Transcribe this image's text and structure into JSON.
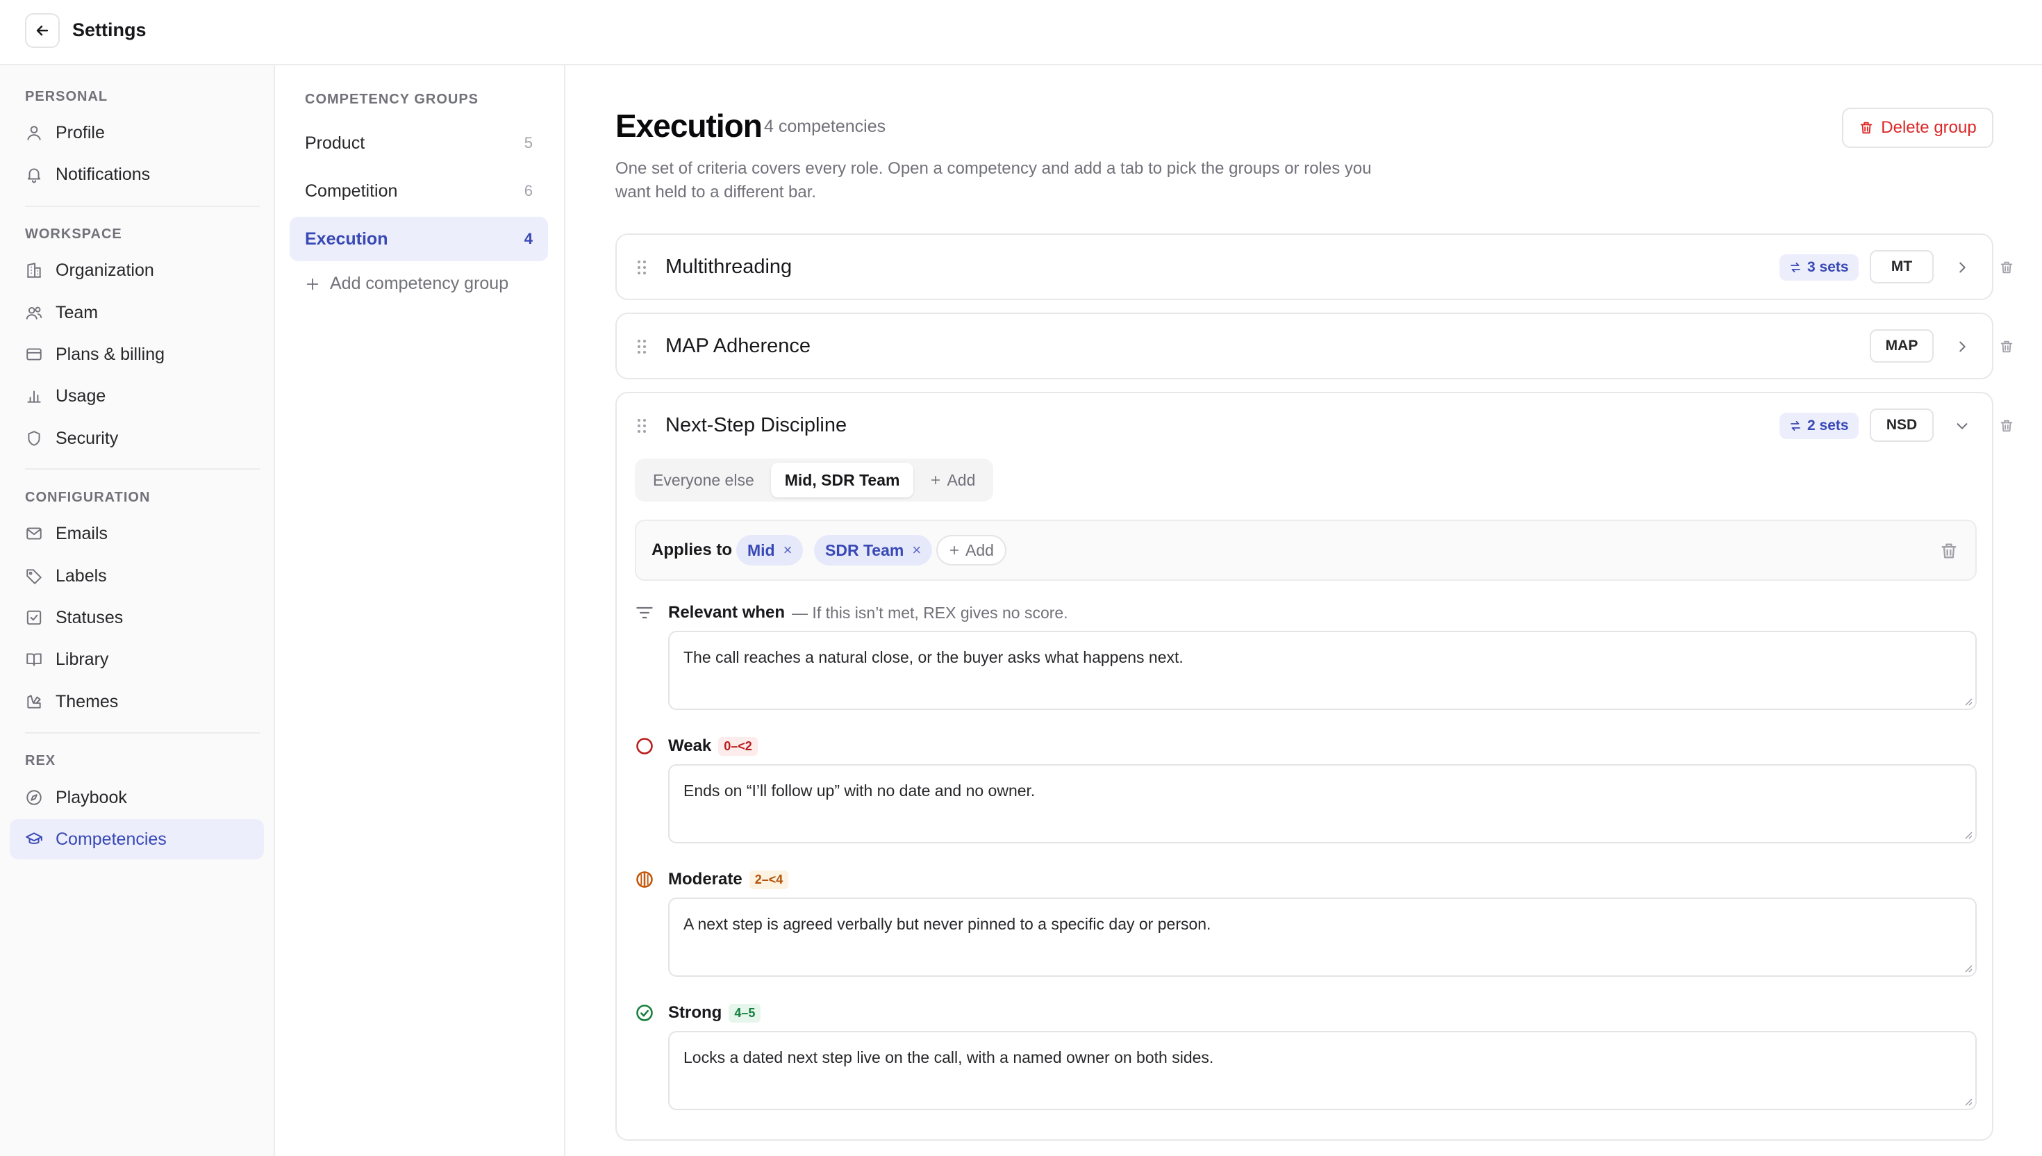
{
  "topbar": {
    "title": "Settings"
  },
  "sidebar": {
    "sections": [
      {
        "label": "PERSONAL",
        "items": [
          {
            "label": "Profile",
            "icon": "user-icon"
          },
          {
            "label": "Notifications",
            "icon": "bell-icon"
          }
        ]
      },
      {
        "label": "WORKSPACE",
        "items": [
          {
            "label": "Organization",
            "icon": "building-icon"
          },
          {
            "label": "Team",
            "icon": "users-icon"
          },
          {
            "label": "Plans & billing",
            "icon": "credit-card-icon"
          },
          {
            "label": "Usage",
            "icon": "bar-chart-icon"
          },
          {
            "label": "Security",
            "icon": "shield-icon"
          }
        ]
      },
      {
        "label": "CONFIGURATION",
        "items": [
          {
            "label": "Emails",
            "icon": "mail-icon"
          },
          {
            "label": "Labels",
            "icon": "tag-icon"
          },
          {
            "label": "Statuses",
            "icon": "check-square-icon"
          },
          {
            "label": "Library",
            "icon": "book-icon"
          },
          {
            "label": "Themes",
            "icon": "palette-icon"
          }
        ]
      },
      {
        "label": "REX",
        "items": [
          {
            "label": "Playbook",
            "icon": "compass-icon"
          },
          {
            "label": "Competencies",
            "icon": "graduation-cap-icon",
            "active": true
          }
        ]
      }
    ]
  },
  "groups": {
    "label": "COMPETENCY GROUPS",
    "items": [
      {
        "label": "Product",
        "count": "5"
      },
      {
        "label": "Competition",
        "count": "6"
      },
      {
        "label": "Execution",
        "count": "4",
        "active": true
      }
    ],
    "add_label": "Add competency group"
  },
  "main": {
    "title": "Execution",
    "subtitle": "4 competencies",
    "description": "One set of criteria covers every role. Open a competency and add a tab to pick the groups or roles you want held to a different bar.",
    "delete_label": "Delete group",
    "competencies": [
      {
        "name": "Multithreading",
        "sets": "3 sets",
        "code": "MT"
      },
      {
        "name": "MAP Adherence",
        "code": "MAP"
      },
      {
        "name": "Next-Step Discipline",
        "sets": "2 sets",
        "code": "NSD",
        "tabs": [
          "Everyone else",
          "Mid, SDR Team"
        ],
        "tab_add": "Add",
        "applies_label": "Applies to",
        "chips": [
          "Mid",
          "SDR Team"
        ],
        "chip_remove": "×",
        "applies_add": "Add",
        "relevant": {
          "title": "Relevant when",
          "hint": "— If this isn’t met, REX gives no score.",
          "text": "The call reaches a natural close, or the buyer asks what happens next."
        },
        "weak": {
          "title": "Weak",
          "range": "0–<2",
          "text": "Ends on “I’ll follow up” with no date and no owner."
        },
        "moderate": {
          "title": "Moderate",
          "range": "2–<4",
          "text": "A next step is agreed verbally but never pinned to a specific day or person."
        },
        "strong": {
          "title": "Strong",
          "range": "4–5",
          "text": "Locks a dated next step live on the call, with a named owner on both sides."
        }
      }
    ]
  },
  "colors": {
    "accent": "#3848b5",
    "accent_bg": "#eceefb",
    "danger": "#dc2626",
    "weak": "#b91c1c",
    "moderate": "#c2570c",
    "strong": "#15803d"
  }
}
